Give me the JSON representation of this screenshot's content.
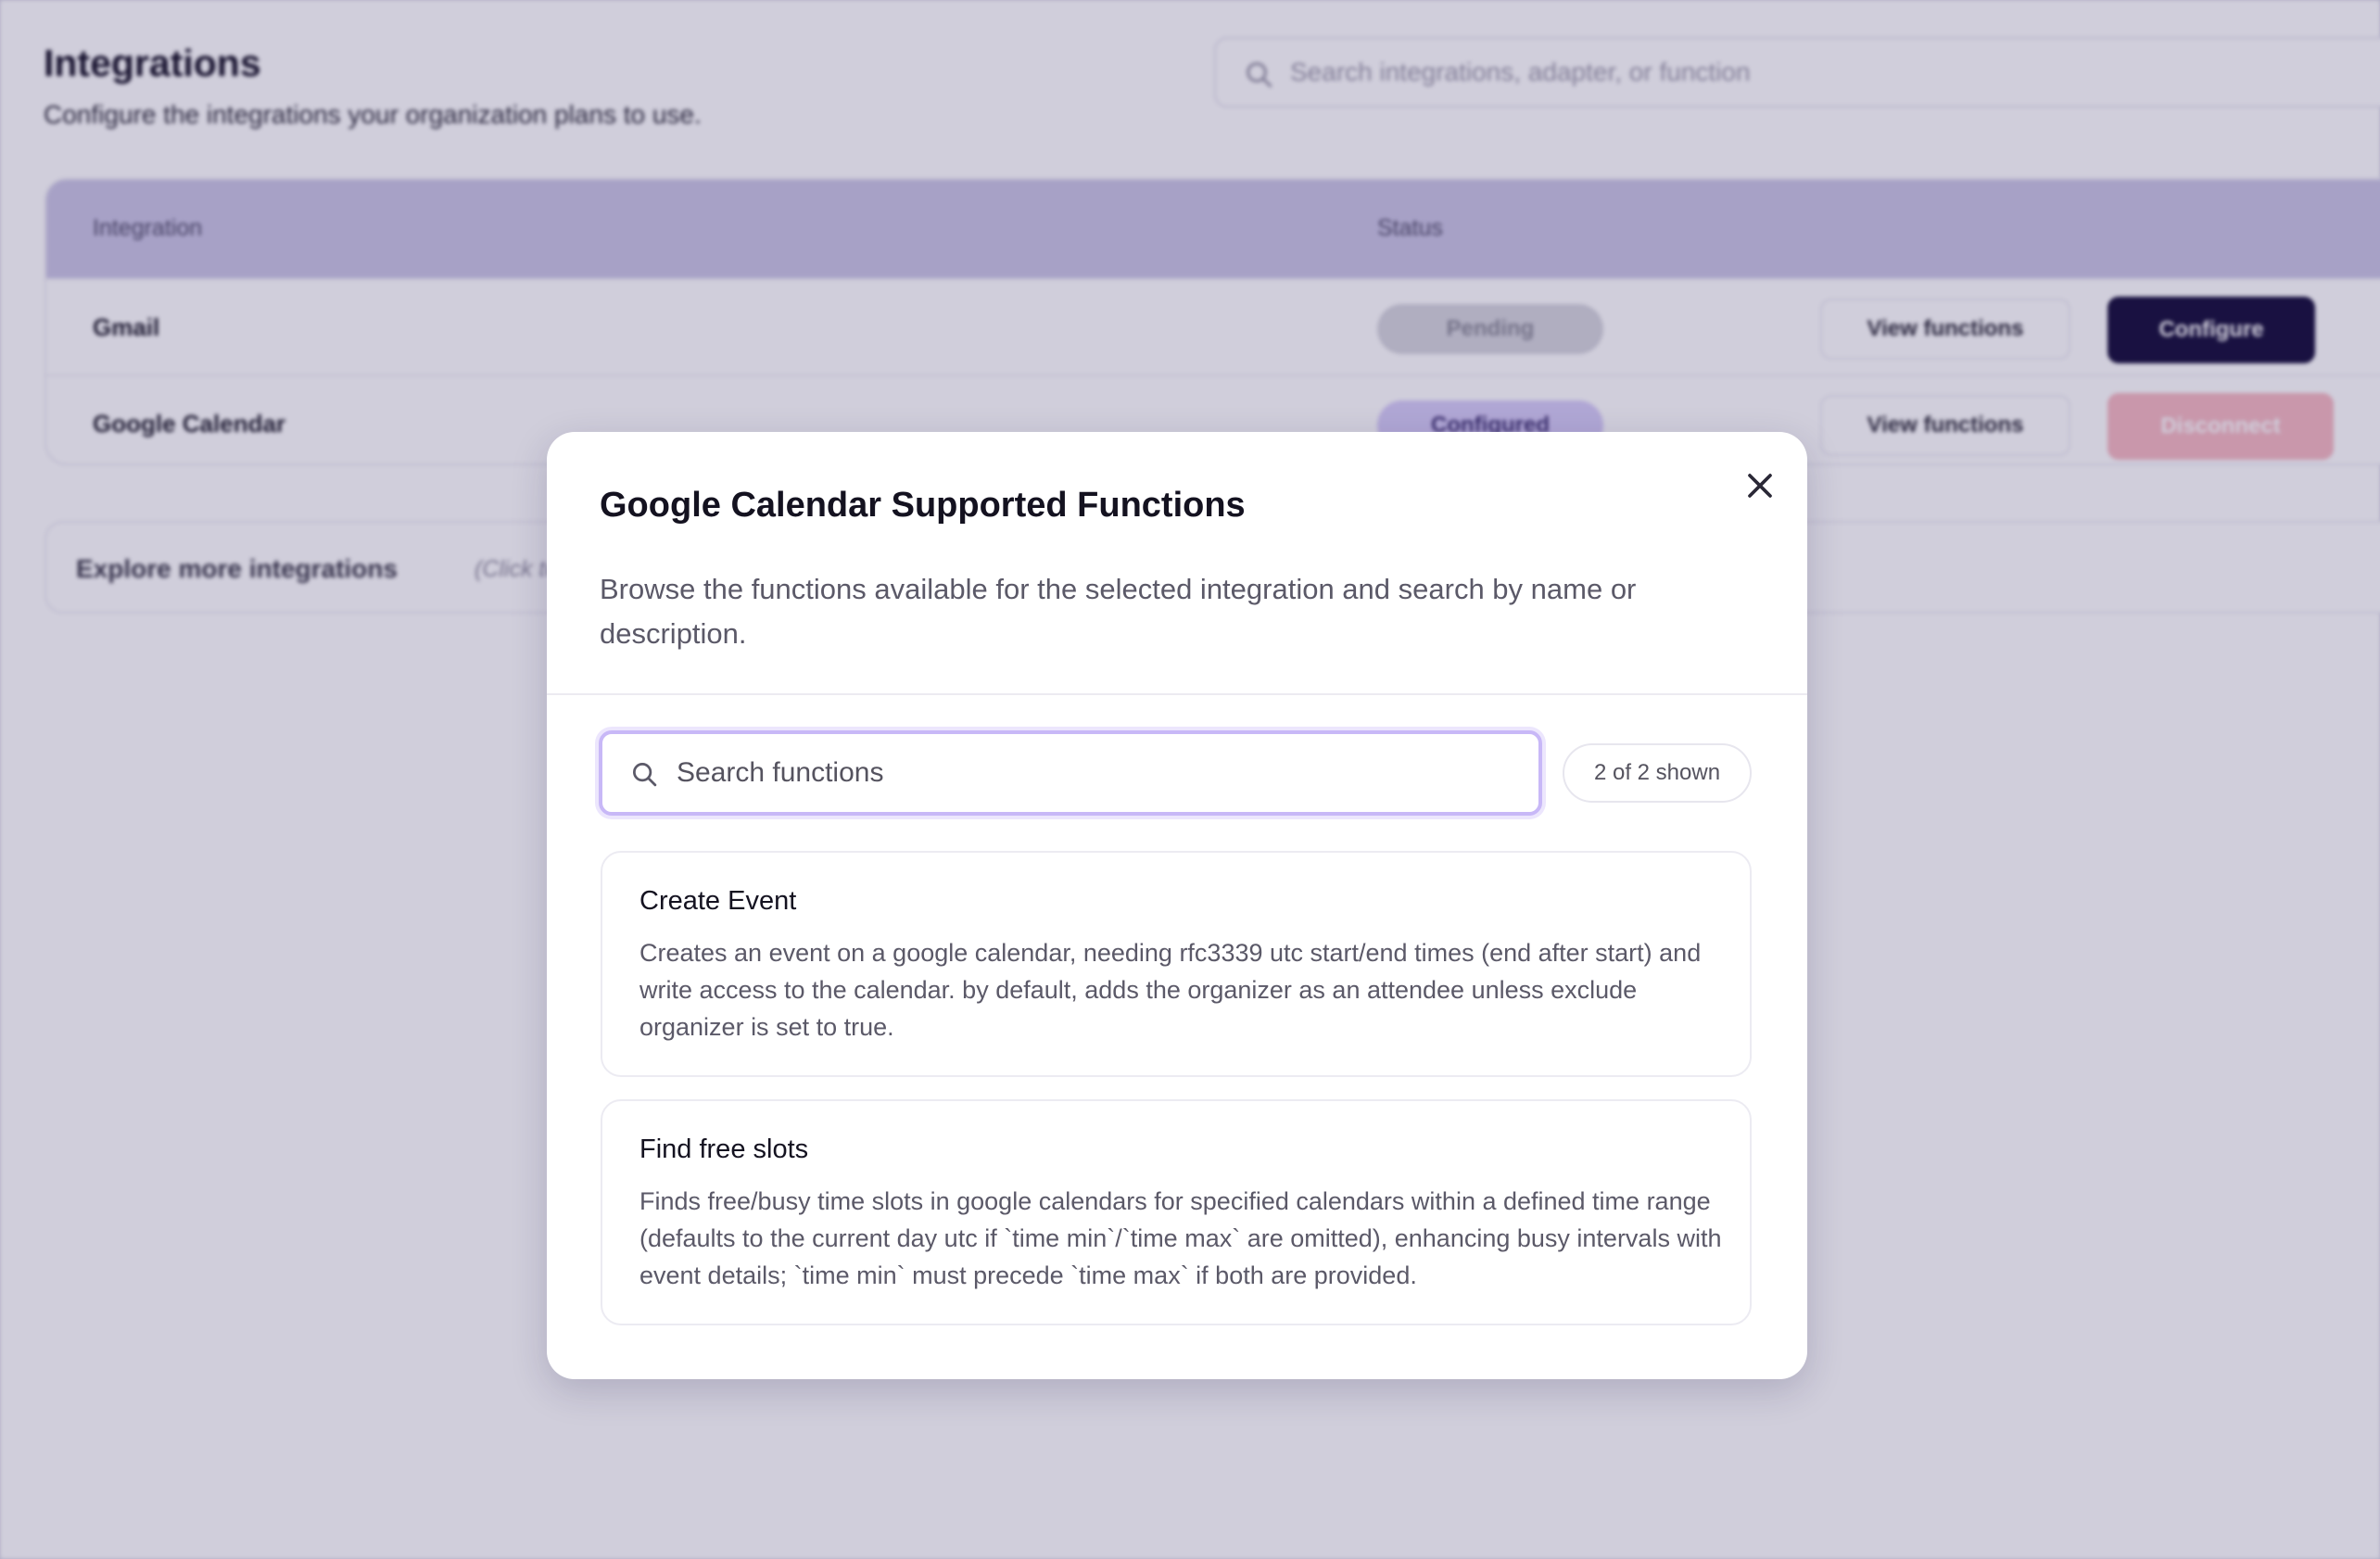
{
  "page": {
    "title": "Integrations",
    "subtitle": "Configure the integrations your organization plans to use.",
    "search_placeholder": "Search integrations, adapter, or function"
  },
  "table": {
    "headers": {
      "integration": "Integration",
      "status": "Status"
    },
    "rows": [
      {
        "name": "Gmail",
        "status": "Pending",
        "view_label": "View functions",
        "action_label": "Configure"
      },
      {
        "name": "Google Calendar",
        "status": "Configured",
        "view_label": "View functions",
        "action_label": "Disconnect"
      }
    ]
  },
  "explore": {
    "title": "Explore more integrations",
    "hint": "(Click to ex"
  },
  "modal": {
    "title": "Google Calendar Supported Functions",
    "description": "Browse the functions available for the selected integration and search by name or description.",
    "search_placeholder": "Search functions",
    "search_value": "",
    "count_label": "2 of 2 shown",
    "functions": [
      {
        "name": "Create Event",
        "description": "Creates an event on a google calendar, needing rfc3339 utc start/end times (end after start) and write access to the calendar. by default, adds the organizer as an attendee unless exclude organizer is set to true."
      },
      {
        "name": "Find free slots",
        "description": "Finds free/busy time slots in google calendars for specified calendars within a defined time range (defaults to the current day utc if `time min`/`time max` are omitted), enhancing busy intervals with event details; `time min` must precede `time max` if both are provided."
      }
    ]
  },
  "colors": {
    "accent": "#c8b8f7",
    "primary_button": "#150e3a",
    "danger_button": "#f6b9c2",
    "overlay": "#d3d0e0"
  },
  "icons": {
    "modal_close": "close-icon",
    "search": "search-icon"
  }
}
